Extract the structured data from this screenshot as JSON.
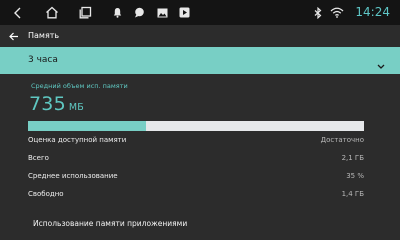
{
  "statusbar": {
    "time": "14:24",
    "icons": [
      "back-icon",
      "home-icon",
      "recents-icon",
      "bell-icon",
      "message-icon",
      "image-icon",
      "media-icon",
      "bluetooth-icon",
      "wifi-icon"
    ]
  },
  "appbar": {
    "title": "Память"
  },
  "period": {
    "selected": "3 часа"
  },
  "average": {
    "label": "Средний объем исп. памяти",
    "value": "735",
    "unit": "МБ",
    "usage_fraction": 0.35
  },
  "stats": [
    {
      "label": "Оценка доступной памяти",
      "value": "Достаточно"
    },
    {
      "label": "Всего",
      "value": "2,1 ГБ"
    },
    {
      "label": "Среднее использование",
      "value": "35 %"
    },
    {
      "label": "Свободно",
      "value": "1,4 ГБ"
    }
  ],
  "apps_link": "Использование памяти приложениями",
  "colors": {
    "accent": "#78cfc5",
    "background": "#2c2c2c",
    "statusbar": "#141414",
    "clock": "#5ec6c6"
  }
}
